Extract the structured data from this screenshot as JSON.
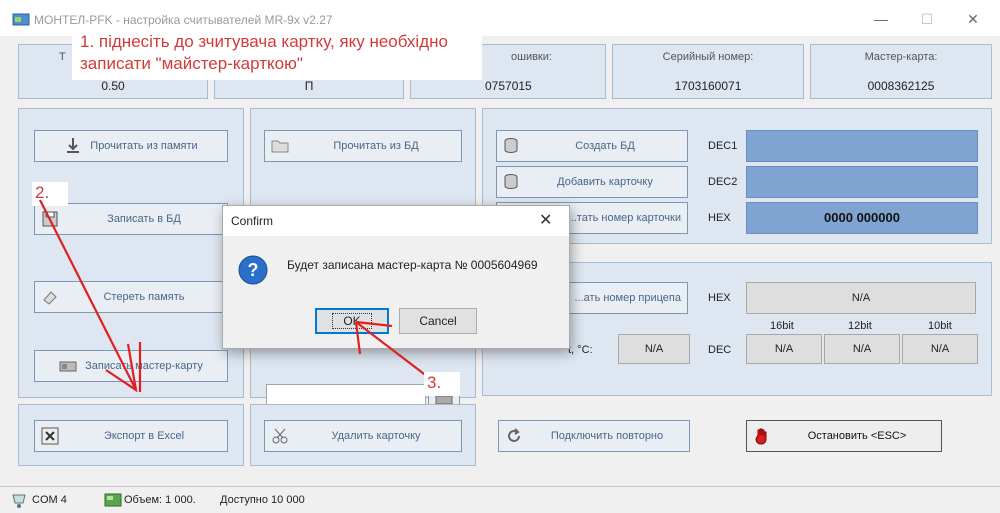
{
  "window": {
    "title": "МОНТЕЛ-РFK - настройка считывателей MR-9x v2.27",
    "controls": [
      "—",
      "☐",
      "✕"
    ]
  },
  "info": [
    {
      "label": "Т",
      "value": "0.50"
    },
    {
      "label": "",
      "value": "П"
    },
    {
      "label": "ошивки:",
      "value": "0757015"
    },
    {
      "label": "Серийный номер:",
      "value": "1703160071"
    },
    {
      "label": "Мастер-карта:",
      "value": "0008362125"
    }
  ],
  "left_buttons": {
    "read_memory": "Прочитать из памяти",
    "write_db": "Записать в БД",
    "erase_memory": "Стереть память",
    "write_master": "Записать мастер-карту",
    "export_excel": "Экспорт в Excel"
  },
  "mid_buttons": {
    "read_db": "Прочитать из БД",
    "delete_cards": "Удалить карточку"
  },
  "right_panel": {
    "create_db": "Создать БД",
    "add_card": "Добавить карточку",
    "read_card_number": "...тать номер карточки",
    "dec1_label": "DEC1",
    "dec2_label": "DEC2",
    "hex_label": "HEX",
    "hex_value": "0000 000000"
  },
  "trailer_panel": {
    "read_trailer": "...ать номер прицепа",
    "hex_label": "HEX",
    "hex_value": "N/A",
    "col_headers": [
      "16bit",
      "12bit",
      "10bit"
    ],
    "temp_label": "t, °C:",
    "temp_value": "N/A",
    "dec_label": "DEC",
    "dec_values": [
      "N/A",
      "N/A",
      "N/A"
    ]
  },
  "bottom_buttons": {
    "reconnect": "Подключить повторно",
    "stop": "Остановить <ESC>"
  },
  "statusbar": {
    "port": "COM 4",
    "volume": "Объем: 1 000.",
    "available": "Доступно 10 000"
  },
  "dialog": {
    "title": "Confirm",
    "message": "Будет записана мастер-карта № 0005604969",
    "ok": "OK",
    "cancel": "Cancel"
  },
  "annotations": {
    "step1_line1": "1. піднесіть до зчитувача картку, яку необхідно",
    "step1_line2": "записати \"майстер-карткою\"",
    "step2": "2.",
    "step3": "3."
  },
  "colors": {
    "annotation_red": "#d23a3a",
    "panel_bg": "#dde6f1",
    "field_blue": "#7fa4d2"
  }
}
